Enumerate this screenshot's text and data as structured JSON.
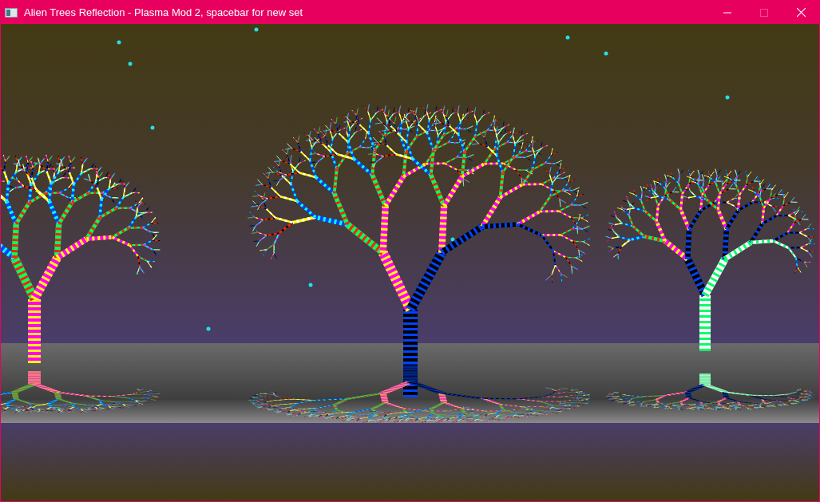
{
  "window": {
    "title": "Alien Trees Reflection - Plasma Mod 2, spacebar for new set",
    "maximize_disabled": true
  }
}
